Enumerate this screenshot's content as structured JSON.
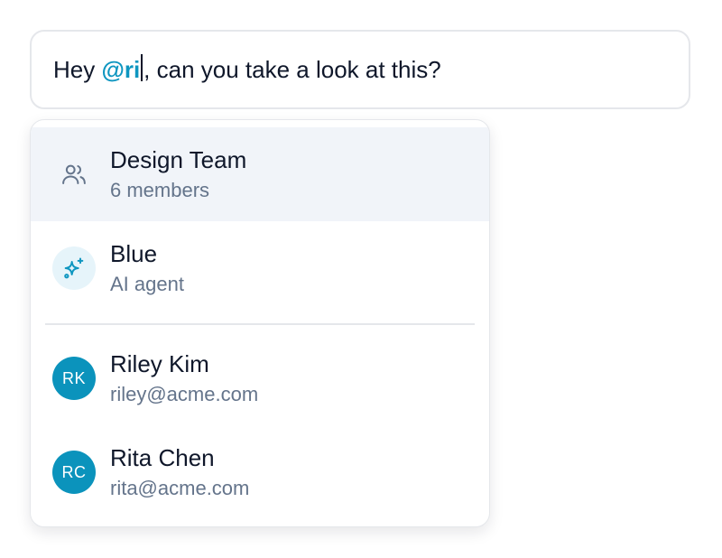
{
  "composer": {
    "text_before": "Hey ",
    "mention": "@ri",
    "text_after": ", can you take a look at this?"
  },
  "suggestions": {
    "items": [
      {
        "name": "Design Team",
        "subtitle": "6 members",
        "type": "group",
        "icon": "users-icon"
      },
      {
        "name": "Blue",
        "subtitle": "AI agent",
        "type": "agent",
        "icon": "sparkles-icon"
      },
      {
        "name": "Riley Kim",
        "subtitle": "riley@acme.com",
        "type": "user",
        "initials": "RK"
      },
      {
        "name": "Rita Chen",
        "subtitle": "rita@acme.com",
        "type": "user",
        "initials": "RC"
      }
    ]
  },
  "colors": {
    "accent": "#0e96c0",
    "avatar": "#0b93bc",
    "highlight": "#f1f4f9",
    "muted_text": "#64748b"
  }
}
